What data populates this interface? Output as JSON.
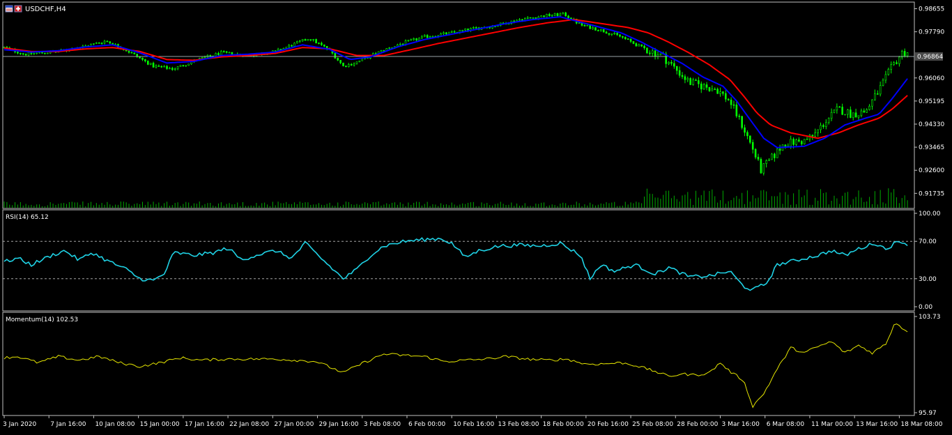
{
  "window": {
    "symbol": "USDCHF,H4"
  },
  "colors": {
    "background": "#000000",
    "frame": "#c0c0c0",
    "text": "#ffffff",
    "bull_candle": "#00ff00",
    "bear_candle": "#00ff00",
    "ma_fast": "#0000ff",
    "ma_slow": "#ff0000",
    "volume": "#00aa00",
    "rsi": "#1fd3e6",
    "momentum": "#e6e600",
    "level_line": "#c0c0c0",
    "price_line": "#9aa3a8",
    "current_price_box": "#4a4a4a"
  },
  "chart_data": [
    {
      "type": "candlestick",
      "title": "USDCHF,H4",
      "ylim": [
        0.913,
        0.9885
      ],
      "y_ticks": [
        "0.98655",
        "0.97790",
        "0.96060",
        "0.95195",
        "0.94330",
        "0.93465",
        "0.92600",
        "0.91735"
      ],
      "current_price": "0.96864",
      "series": [
        {
          "name": "price",
          "anchors": [
            [
              0,
              0.972
            ],
            [
              15,
              0.9695
            ],
            [
              40,
              0.9705
            ],
            [
              60,
              0.9725
            ],
            [
              75,
              0.9745
            ],
            [
              90,
              0.971
            ],
            [
              110,
              0.965
            ],
            [
              125,
              0.964
            ],
            [
              140,
              0.967
            ],
            [
              160,
              0.97
            ],
            [
              180,
              0.969
            ],
            [
              200,
              0.9705
            ],
            [
              215,
              0.9735
            ],
            [
              225,
              0.9755
            ],
            [
              240,
              0.971
            ],
            [
              250,
              0.965
            ],
            [
              260,
              0.9665
            ],
            [
              275,
              0.97
            ],
            [
              290,
              0.973
            ],
            [
              310,
              0.976
            ],
            [
              330,
              0.9775
            ],
            [
              345,
              0.979
            ],
            [
              360,
              0.98
            ],
            [
              380,
              0.9825
            ],
            [
              400,
              0.984
            ],
            [
              413,
              0.9845
            ],
            [
              425,
              0.9805
            ],
            [
              440,
              0.9785
            ],
            [
              455,
              0.976
            ],
            [
              470,
              0.972
            ],
            [
              485,
              0.969
            ],
            [
              495,
              0.964
            ],
            [
              505,
              0.959
            ],
            [
              515,
              0.9575
            ],
            [
              525,
              0.9565
            ],
            [
              535,
              0.952
            ],
            [
              545,
              0.942
            ],
            [
              552,
              0.934
            ],
            [
              558,
              0.926
            ],
            [
              565,
              0.93
            ],
            [
              575,
              0.936
            ],
            [
              590,
              0.937
            ],
            [
              597,
              0.939
            ],
            [
              605,
              0.944
            ],
            [
              615,
              0.949
            ],
            [
              625,
              0.947
            ],
            [
              635,
              0.948
            ],
            [
              645,
              0.956
            ],
            [
              655,
              0.965
            ],
            [
              662,
              0.97
            ],
            [
              667,
              0.9705
            ]
          ]
        },
        {
          "name": "ma_fast",
          "anchors": [
            [
              0,
              0.9712
            ],
            [
              20,
              0.9703
            ],
            [
              40,
              0.9708
            ],
            [
              60,
              0.9722
            ],
            [
              80,
              0.973
            ],
            [
              100,
              0.97
            ],
            [
              120,
              0.9662
            ],
            [
              140,
              0.9668
            ],
            [
              160,
              0.969
            ],
            [
              180,
              0.9695
            ],
            [
              200,
              0.9703
            ],
            [
              220,
              0.973
            ],
            [
              240,
              0.9713
            ],
            [
              255,
              0.9675
            ],
            [
              270,
              0.9685
            ],
            [
              290,
              0.9722
            ],
            [
              310,
              0.975
            ],
            [
              330,
              0.977
            ],
            [
              350,
              0.979
            ],
            [
              370,
              0.981
            ],
            [
              390,
              0.9825
            ],
            [
              410,
              0.9835
            ],
            [
              425,
              0.9815
            ],
            [
              440,
              0.9795
            ],
            [
              455,
              0.9775
            ],
            [
              470,
              0.974
            ],
            [
              485,
              0.97
            ],
            [
              500,
              0.966
            ],
            [
              515,
              0.961
            ],
            [
              530,
              0.9575
            ],
            [
              540,
              0.952
            ],
            [
              550,
              0.945
            ],
            [
              560,
              0.938
            ],
            [
              570,
              0.9345
            ],
            [
              590,
              0.935
            ],
            [
              605,
              0.938
            ],
            [
              620,
              0.943
            ],
            [
              635,
              0.9455
            ],
            [
              645,
              0.947
            ],
            [
              655,
              0.953
            ],
            [
              667,
              0.961
            ]
          ]
        },
        {
          "name": "ma_slow",
          "anchors": [
            [
              0,
              0.9718
            ],
            [
              20,
              0.9705
            ],
            [
              40,
              0.9705
            ],
            [
              60,
              0.9715
            ],
            [
              80,
              0.972
            ],
            [
              100,
              0.9705
            ],
            [
              120,
              0.9675
            ],
            [
              140,
              0.9672
            ],
            [
              160,
              0.9685
            ],
            [
              180,
              0.969
            ],
            [
              200,
              0.9698
            ],
            [
              220,
              0.972
            ],
            [
              240,
              0.9715
            ],
            [
              260,
              0.969
            ],
            [
              280,
              0.969
            ],
            [
              300,
              0.9712
            ],
            [
              320,
              0.9735
            ],
            [
              340,
              0.9755
            ],
            [
              360,
              0.9775
            ],
            [
              380,
              0.9795
            ],
            [
              400,
              0.9812
            ],
            [
              420,
              0.9825
            ],
            [
              440,
              0.981
            ],
            [
              460,
              0.9795
            ],
            [
              475,
              0.9775
            ],
            [
              490,
              0.974
            ],
            [
              505,
              0.97
            ],
            [
              520,
              0.9655
            ],
            [
              535,
              0.96
            ],
            [
              545,
              0.954
            ],
            [
              555,
              0.9475
            ],
            [
              565,
              0.943
            ],
            [
              580,
              0.94
            ],
            [
              600,
              0.938
            ],
            [
              615,
              0.94
            ],
            [
              630,
              0.943
            ],
            [
              645,
              0.9455
            ],
            [
              655,
              0.949
            ],
            [
              667,
              0.9545
            ]
          ]
        }
      ]
    },
    {
      "type": "line",
      "title": "RSI(14) 65.12",
      "ylim": [
        0,
        100
      ],
      "levels": [
        30,
        70
      ],
      "y_ticks": [
        "100.00",
        "70.00",
        "30.00",
        "0.00"
      ],
      "series": [
        {
          "name": "RSI(14)",
          "anchors": [
            [
              0,
              48
            ],
            [
              10,
              52
            ],
            [
              20,
              45
            ],
            [
              35,
              55
            ],
            [
              45,
              60
            ],
            [
              55,
              50
            ],
            [
              65,
              58
            ],
            [
              75,
              50
            ],
            [
              90,
              40
            ],
            [
              100,
              30
            ],
            [
              110,
              28
            ],
            [
              118,
              35
            ],
            [
              125,
              58
            ],
            [
              140,
              55
            ],
            [
              155,
              58
            ],
            [
              165,
              63
            ],
            [
              175,
              50
            ],
            [
              185,
              55
            ],
            [
              200,
              60
            ],
            [
              212,
              52
            ],
            [
              222,
              68
            ],
            [
              235,
              50
            ],
            [
              250,
              30
            ],
            [
              260,
              40
            ],
            [
              270,
              55
            ],
            [
              280,
              65
            ],
            [
              295,
              70
            ],
            [
              310,
              72
            ],
            [
              322,
              73
            ],
            [
              330,
              68
            ],
            [
              340,
              53
            ],
            [
              350,
              60
            ],
            [
              365,
              65
            ],
            [
              380,
              66
            ],
            [
              395,
              65
            ],
            [
              410,
              68
            ],
            [
              425,
              55
            ],
            [
              432,
              30
            ],
            [
              440,
              45
            ],
            [
              450,
              38
            ],
            [
              465,
              45
            ],
            [
              480,
              35
            ],
            [
              490,
              42
            ],
            [
              505,
              32
            ],
            [
              520,
              33
            ],
            [
              535,
              38
            ],
            [
              545,
              22
            ],
            [
              552,
              18
            ],
            [
              562,
              25
            ],
            [
              570,
              45
            ],
            [
              585,
              50
            ],
            [
              600,
              55
            ],
            [
              610,
              60
            ],
            [
              620,
              55
            ],
            [
              630,
              62
            ],
            [
              642,
              68
            ],
            [
              650,
              62
            ],
            [
              657,
              68
            ],
            [
              662,
              70
            ],
            [
              667,
              65
            ]
          ]
        }
      ]
    },
    {
      "type": "line",
      "title": "Momentum(14) 102.53",
      "ylim": [
        95.97,
        103.73
      ],
      "y_ticks": [
        "103.73",
        "95.97"
      ],
      "series": [
        {
          "name": "Momentum(14)",
          "anchors": [
            [
              0,
              100.4
            ],
            [
              10,
              100.5
            ],
            [
              25,
              100.0
            ],
            [
              40,
              100.5
            ],
            [
              55,
              100.2
            ],
            [
              70,
              100.5
            ],
            [
              85,
              100.0
            ],
            [
              100,
              99.7
            ],
            [
              115,
              100.0
            ],
            [
              130,
              100.4
            ],
            [
              145,
              100.2
            ],
            [
              165,
              100.3
            ],
            [
              185,
              100.3
            ],
            [
              200,
              100.3
            ],
            [
              215,
              100.2
            ],
            [
              230,
              100.1
            ],
            [
              250,
              99.2
            ],
            [
              265,
              100.0
            ],
            [
              280,
              100.7
            ],
            [
              295,
              100.6
            ],
            [
              310,
              100.5
            ],
            [
              325,
              100.1
            ],
            [
              340,
              100.2
            ],
            [
              355,
              100.3
            ],
            [
              370,
              100.5
            ],
            [
              385,
              100.3
            ],
            [
              400,
              100.2
            ],
            [
              415,
              100.3
            ],
            [
              428,
              99.9
            ],
            [
              440,
              99.9
            ],
            [
              455,
              100.0
            ],
            [
              465,
              99.8
            ],
            [
              480,
              99.3
            ],
            [
              490,
              98.9
            ],
            [
              500,
              99.1
            ],
            [
              510,
              99.0
            ],
            [
              520,
              99.2
            ],
            [
              528,
              100.0
            ],
            [
              535,
              99.3
            ],
            [
              545,
              98.6
            ],
            [
              552,
              96.5
            ],
            [
              560,
              97.5
            ],
            [
              570,
              99.5
            ],
            [
              580,
              101.2
            ],
            [
              590,
              100.8
            ],
            [
              600,
              101.3
            ],
            [
              610,
              101.7
            ],
            [
              620,
              100.8
            ],
            [
              630,
              101.4
            ],
            [
              640,
              100.8
            ],
            [
              650,
              101.5
            ],
            [
              657,
              103.3
            ],
            [
              662,
              102.8
            ],
            [
              667,
              102.53
            ]
          ]
        }
      ]
    }
  ],
  "x_axis": {
    "labels": [
      {
        "t": 0,
        "text": "3 Jan 2020"
      },
      {
        "t": 33,
        "text": "7 Jan 16:00"
      },
      {
        "t": 66,
        "text": "10 Jan 08:00"
      },
      {
        "t": 99,
        "text": "15 Jan 00:00"
      },
      {
        "t": 132,
        "text": "17 Jan 16:00"
      },
      {
        "t": 165,
        "text": "22 Jan 08:00"
      },
      {
        "t": 198,
        "text": "27 Jan 00:00"
      },
      {
        "t": 231,
        "text": "29 Jan 16:00"
      },
      {
        "t": 264,
        "text": "3 Feb 08:00"
      },
      {
        "t": 297,
        "text": "6 Feb 00:00"
      },
      {
        "t": 330,
        "text": "10 Feb 16:00"
      },
      {
        "t": 363,
        "text": "13 Feb 08:00"
      },
      {
        "t": 396,
        "text": "18 Feb 00:00"
      },
      {
        "t": 429,
        "text": "20 Feb 16:00"
      },
      {
        "t": 462,
        "text": "25 Feb 08:00"
      },
      {
        "t": 495,
        "text": "28 Feb 00:00"
      },
      {
        "t": 528,
        "text": "3 Mar 16:00"
      },
      {
        "t": 561,
        "text": "6 Mar 08:00"
      },
      {
        "t": 594,
        "text": "11 Mar 00:00"
      },
      {
        "t": 627,
        "text": "13 Mar 16:00"
      },
      {
        "t": 660,
        "text": "18 Mar 08:00"
      }
    ]
  }
}
